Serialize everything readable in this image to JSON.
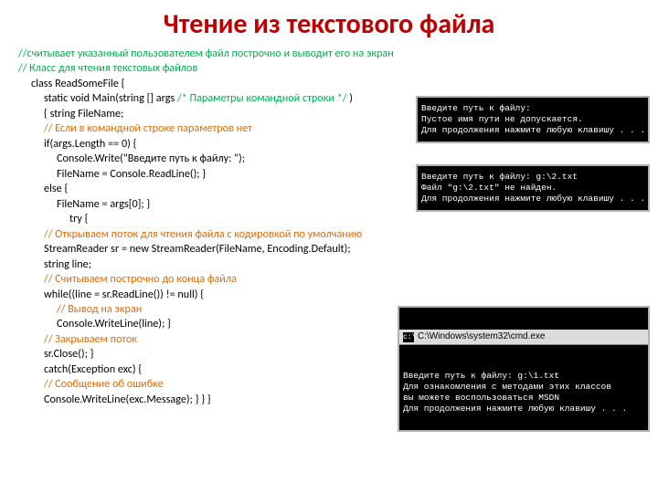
{
  "title": "Чтение из текстового файла",
  "code": {
    "c1": "//считывает указанный пользователем файл построчно и выводит его на экран",
    "c2": "// Класс для чтения текстовых файлов",
    "l1a": "class ReadSomeFile    {",
    "l2a": "static void Main(string [] args ",
    "l2b": "/* Параметры командной строки */ ",
    "l2c": " )",
    "l3a": "{            string FileName;",
    "c3": "// Если в командной строке параметров нет",
    "l4a": "if(args.Length == 0)            {",
    "l5a": "Console.Write(\"Введите путь к файлу: \");",
    "l6a": "FileName = Console.ReadLine();            }",
    "l7a": "else            {",
    "l8a": "FileName = args[0];            }",
    "l9a": "try            {",
    "c4": "// Открываем поток для чтения файла  с кодировкой  по умолчанию",
    "l10a": "StreamReader sr = new StreamReader(FileName, Encoding.Default);",
    "l11a": "string line;",
    "c5": "// Считываем построчно до конца файла",
    "l12a": "while((line = sr.ReadLine()) != null)                {",
    "c6": "// Вывод на экран",
    "l13a": "Console.WriteLine(line);                }",
    "c7": "// Закрываем поток",
    "l14a": "sr.Close();            }",
    "l15a": "catch(Exception exc)            {",
    "c8": "// Сообщение об ошибке",
    "l16a": "Console.WriteLine(exc.Message);            }        }    }"
  },
  "console1": "Введите путь к файлу:\nПустое имя пути не допускается.\nДля продолжения нажмите любую клавишу . . .",
  "console2": "Введите путь к файлу: g:\\2.txt\nФайл \"g:\\2.txt\" не найден.\nДля продолжения нажмите любую клавишу . . .",
  "console3": {
    "titlebar": "C:\\Windows\\system32\\cmd.exe",
    "body": "Введите путь к файлу: g:\\1.txt\nДля ознакомления с методами этих классов\nвы можете воспользоваться MSDN\nДля продолжения нажмите любую клавишу . . ."
  }
}
